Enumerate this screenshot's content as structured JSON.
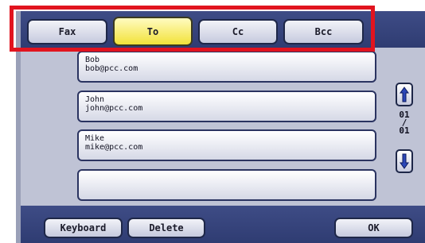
{
  "tabs": [
    {
      "label": "Fax"
    },
    {
      "label": "To",
      "active": true
    },
    {
      "label": "Cc"
    },
    {
      "label": "Bcc"
    }
  ],
  "contacts": [
    {
      "name": "Bob",
      "email": "bob@pcc.com"
    },
    {
      "name": "John",
      "email": "john@pcc.com"
    },
    {
      "name": "Mike",
      "email": "mike@pcc.com"
    },
    {
      "name": "",
      "email": ""
    }
  ],
  "pager": {
    "current": "01",
    "separator": "/",
    "total": "01"
  },
  "footer": {
    "keyboard": "Keyboard",
    "delete": "Delete",
    "ok": "OK"
  },
  "colors": {
    "highlight": "#e1141f",
    "active_tab": "#f2e23a",
    "bar": "#2f3c72",
    "panel": "#bfc3d5"
  },
  "icons": {
    "scroll_up": "arrow-up-icon",
    "scroll_down": "arrow-down-icon"
  }
}
